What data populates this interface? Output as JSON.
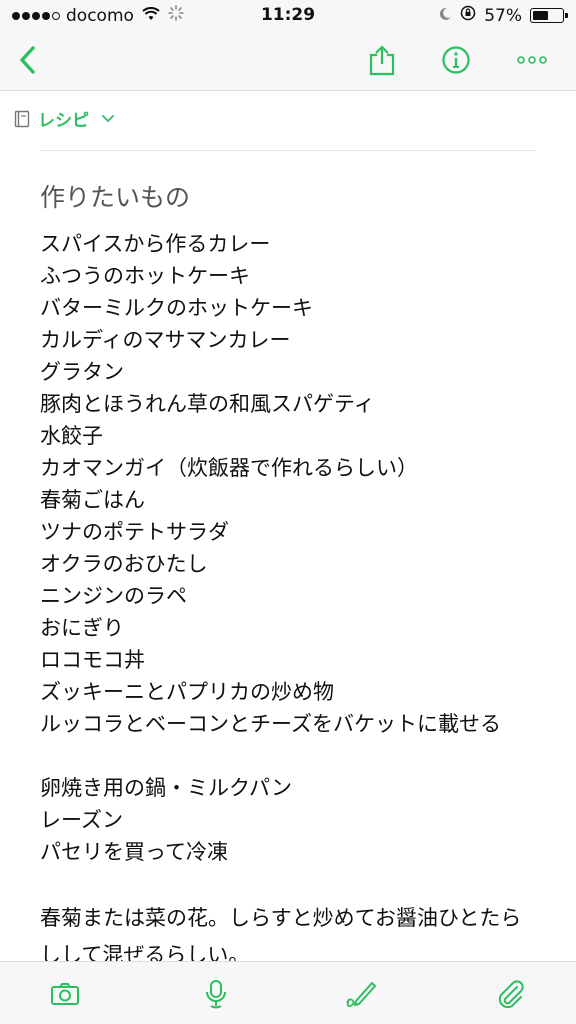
{
  "status_bar": {
    "carrier": "docomo",
    "time": "11:29",
    "battery_percent": "57%",
    "battery_level": 0.57
  },
  "nav": {
    "back_icon": "chevron-left-icon",
    "share_icon": "share-icon",
    "info_icon": "info-icon",
    "more_icon": "more-icon"
  },
  "notebook": {
    "name": "レシピ"
  },
  "note": {
    "title": "作りたいもの",
    "list1": [
      "スパイスから作るカレー",
      "ふつうのホットケーキ",
      "バターミルクのホットケーキ",
      "カルディのマサマンカレー",
      "グラタン",
      "豚肉とほうれん草の和風スパゲティ",
      "水餃子",
      "カオマンガイ（炊飯器で作れるらしい）",
      "春菊ごはん",
      "ツナのポテトサラダ",
      "オクラのおひたし",
      "ニンジンのラペ",
      "おにぎり",
      "ロコモコ丼",
      "ズッキーニとパプリカの炒め物",
      "ルッコラとベーコンとチーズをバケットに載せる"
    ],
    "list2": [
      "卵焼き用の鍋・ミルクパン",
      "レーズン",
      "パセリを買って冷凍"
    ],
    "paragraph": "春菊または菜の花。しらすと炒めてお醤油ひとたらしして混ぜるらしい。"
  },
  "toolbar": {
    "items": [
      "camera-icon",
      "microphone-icon",
      "pen-icon",
      "paperclip-icon"
    ]
  },
  "colors": {
    "accent": "#2dbe60",
    "bar_bg": "#f7f7f7"
  }
}
